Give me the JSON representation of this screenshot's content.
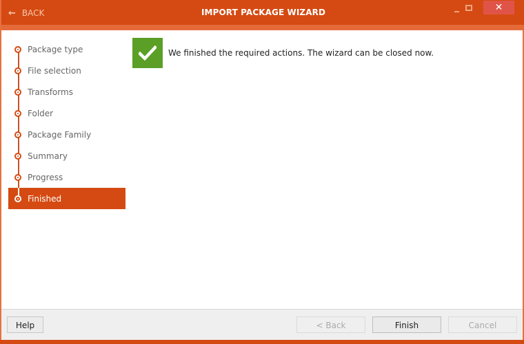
{
  "window": {
    "title": "IMPORT PACKAGE WIZARD",
    "back_label": "BACK",
    "back_icon": "arrow-left-icon",
    "controls": {
      "minimize": "minimize-icon",
      "maximize": "maximize-icon",
      "close": "✕"
    }
  },
  "steps": [
    {
      "label": "Package type",
      "active": false
    },
    {
      "label": "File selection",
      "active": false
    },
    {
      "label": "Transforms",
      "active": false
    },
    {
      "label": "Folder",
      "active": false
    },
    {
      "label": "Package Family",
      "active": false
    },
    {
      "label": "Summary",
      "active": false
    },
    {
      "label": "Progress",
      "active": false
    },
    {
      "label": "Finished",
      "active": true
    }
  ],
  "content": {
    "status_icon": "checkmark-icon",
    "message": "We finished the required actions. The wizard can be closed now."
  },
  "footer": {
    "help_label": "Help",
    "back_label": "< Back",
    "finish_label": "Finish",
    "cancel_label": "Cancel",
    "back_enabled": false,
    "cancel_enabled": false
  },
  "colors": {
    "accent": "#d54a12",
    "accent_light": "#e46a3a",
    "success": "#5b9f26",
    "close_button": "#e05448"
  }
}
